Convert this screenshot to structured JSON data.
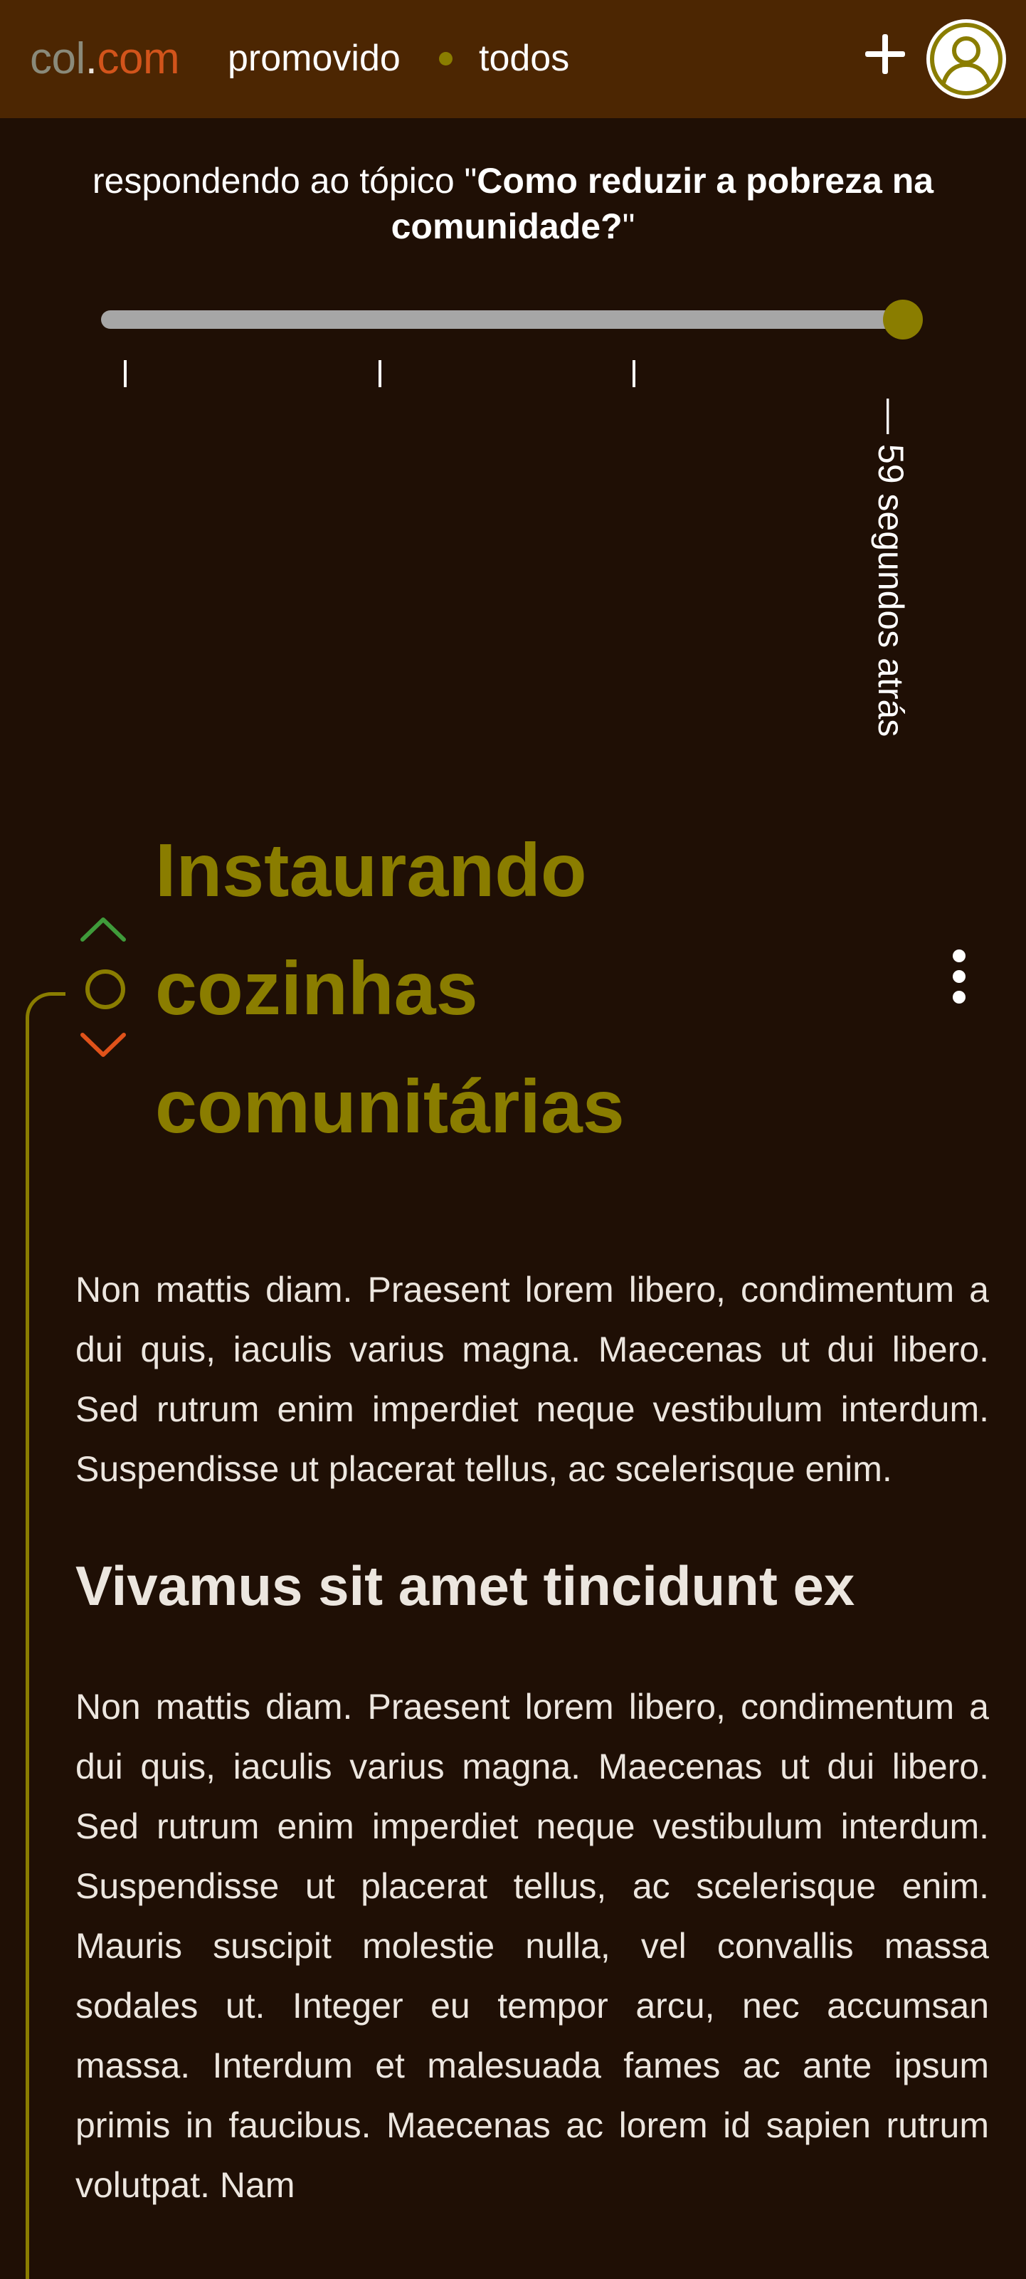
{
  "header": {
    "logo": {
      "part1": "col",
      "part2": ".",
      "part3": "com"
    },
    "nav": {
      "promoted": "promovido",
      "all": "todos"
    },
    "icons": {
      "add": "plus-icon",
      "profile": "user-icon"
    },
    "colors": {
      "bar": "#4c2602",
      "accent": "#8a7d00",
      "brand": "#d2541b"
    }
  },
  "topic": {
    "prefix": "respondendo ao tópico \"",
    "title": "Como reduzir a pobreza na comunidade?",
    "suffix": "\""
  },
  "timeline": {
    "position": 1.0,
    "label": "— 59 segundos atrás"
  },
  "post": {
    "title": "Instaurando cozinhas comunitárias",
    "vote_icons": {
      "up": "chevron-up-icon",
      "neutral": "circle-icon",
      "down": "chevron-down-icon"
    },
    "vote_colors": {
      "up": "#3f9a3a",
      "neutral": "#8a7d00",
      "down": "#e0521a"
    },
    "menu_icon": "more-vertical-icon",
    "paragraph1": "Non mattis diam. Praesent lorem libero, condimentum a dui quis, iaculis varius magna. Maecenas ut dui libero. Sed rutrum enim imperdiet neque vestibulum interdum. Suspendisse ut placerat tellus, ac scelerisque enim.",
    "heading": "Vivamus sit amet tincidunt ex",
    "paragraph2": "Non mattis diam. Praesent lorem libero, condimentum a dui quis, iaculis varius magna. Maecenas ut dui libero. Sed rutrum enim imperdiet neque vestibulum interdum. Suspendisse ut placerat tellus, ac scelerisque enim. Mauris suscipit molestie nulla, vel convallis massa sodales ut. Integer eu tempor arcu, nec accumsan massa. Interdum et malesuada fames ac ante ipsum primis in faucibus. Maecenas ac lorem id sapien rutrum volutpat. Nam"
  }
}
